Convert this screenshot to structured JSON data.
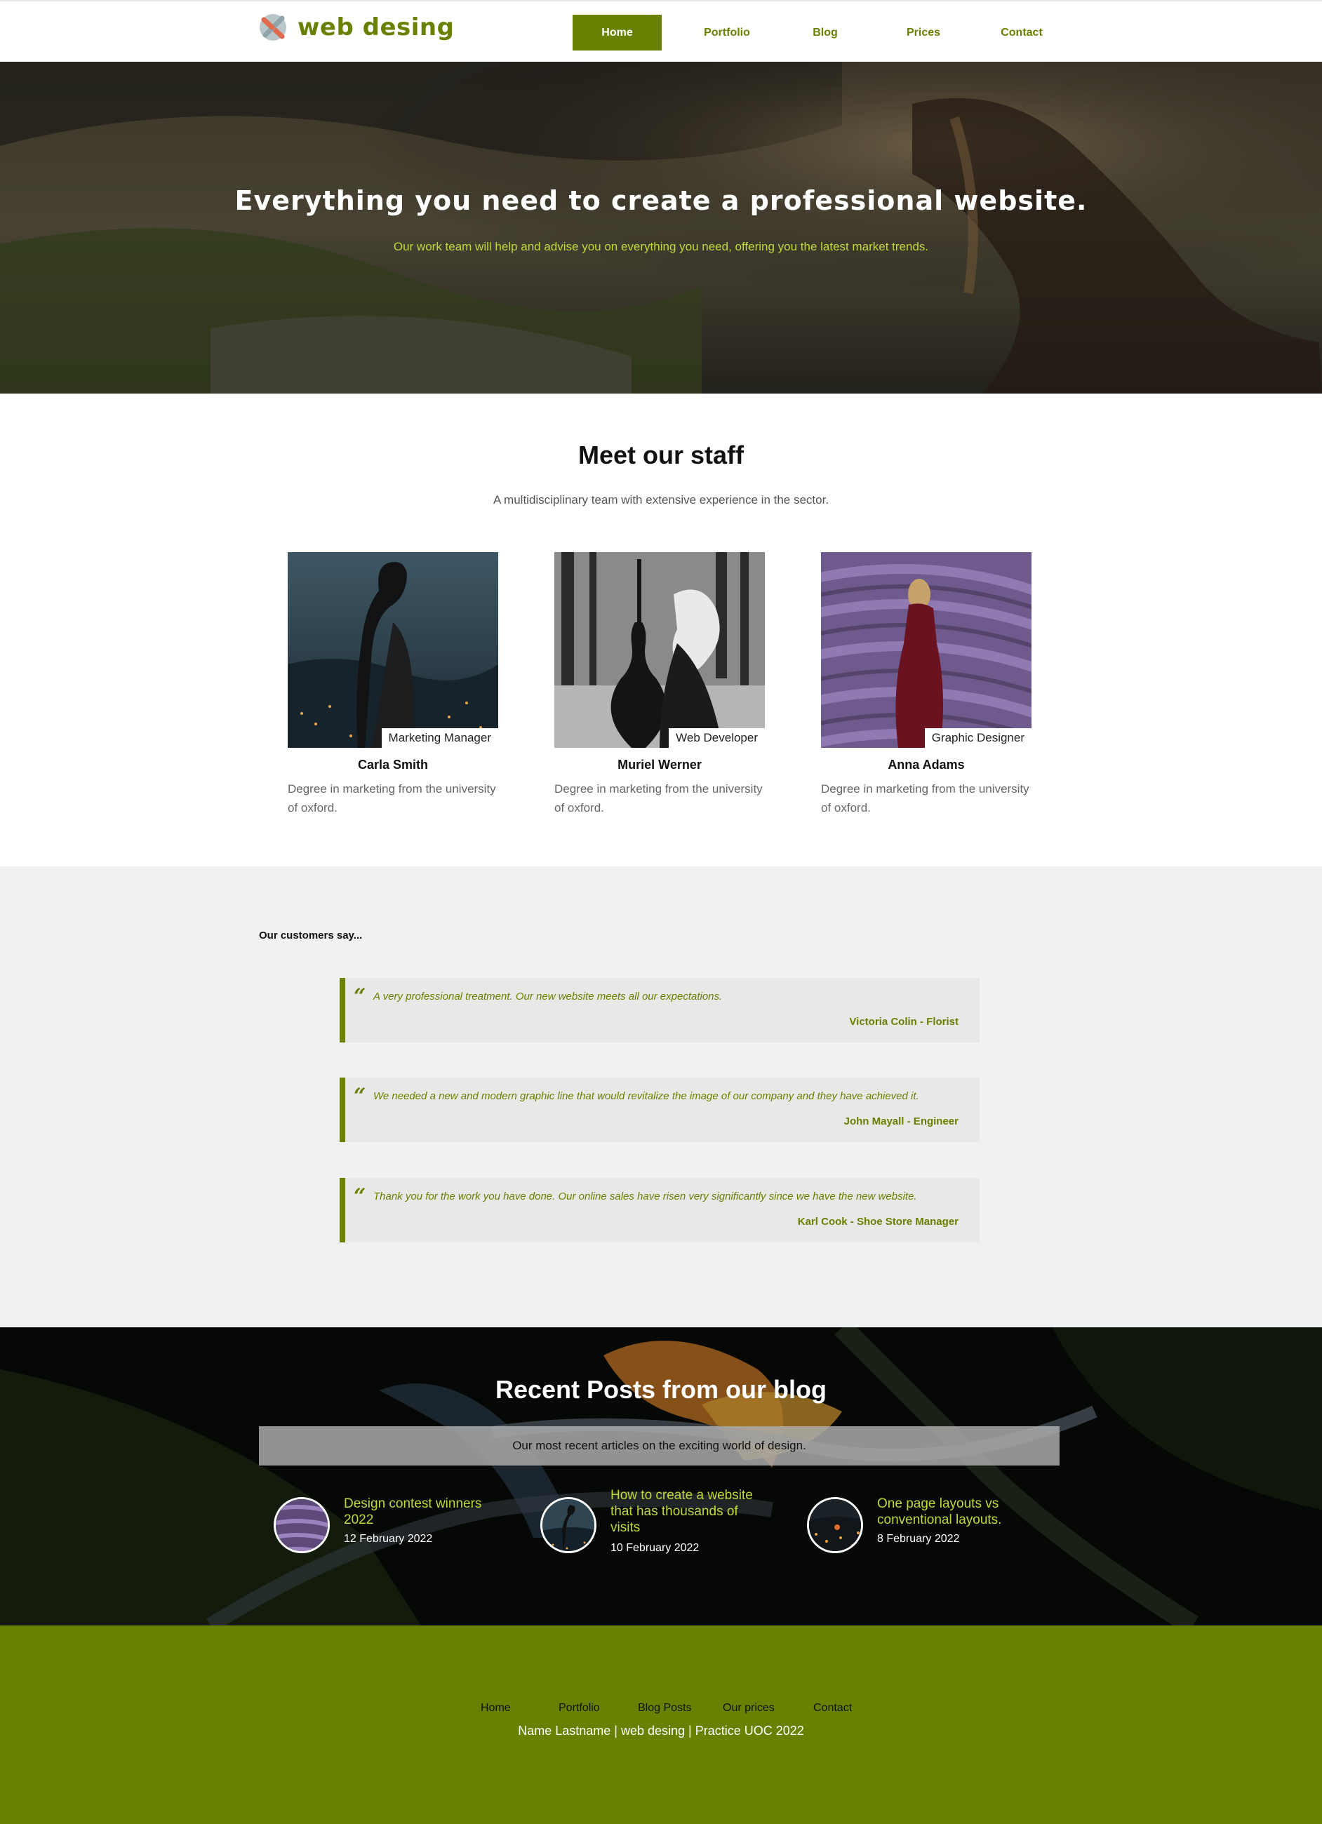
{
  "header": {
    "logo_text": "web desing",
    "nav": [
      {
        "label": "Home",
        "active": true
      },
      {
        "label": "Portfolio",
        "active": false
      },
      {
        "label": "Blog",
        "active": false
      },
      {
        "label": "Prices",
        "active": false
      },
      {
        "label": "Contact",
        "active": false
      }
    ]
  },
  "hero": {
    "title": "Everything you need to create a professional website.",
    "subtitle": "Our work team will help and advise you on everything you need, offering you the latest market trends."
  },
  "staff": {
    "title": "Meet our staff",
    "subtitle": "A multidisciplinary team with extensive experience in the sector.",
    "members": [
      {
        "role": "Marketing Manager",
        "name": "Carla Smith",
        "description": "Degree in marketing from the university of oxford."
      },
      {
        "role": "Web Developer",
        "name": "Muriel Werner",
        "description": "Degree in marketing from the university of oxford."
      },
      {
        "role": "Graphic Designer",
        "name": "Anna Adams",
        "description": "Degree in marketing from the university of oxford."
      }
    ]
  },
  "testimonials": {
    "title": "Our customers say...",
    "items": [
      {
        "quote": "A very professional treatment. Our new website meets all our expectations.",
        "author": "Victoria Colin - Florist"
      },
      {
        "quote": "We needed a new and modern graphic line that would revitalize the image of our company and they have achieved it.",
        "author": "John Mayall - Engineer"
      },
      {
        "quote": "Thank you for the work you have done. Our online sales have risen very significantly since we have the new website.",
        "author": "Karl Cook - Shoe Store Manager"
      }
    ]
  },
  "blog": {
    "title": "Recent Posts from our blog",
    "subtitle": "Our most recent articles on the exciting world of design.",
    "posts": [
      {
        "title": "Design contest winners 2022",
        "date": "12 February 2022"
      },
      {
        "title": "How to create a website that has thousands of visits",
        "date": "10 February 2022"
      },
      {
        "title": "One page layouts vs conventional layouts.",
        "date": "8 February 2022"
      }
    ]
  },
  "footer": {
    "links": [
      "Home",
      "Portfolio",
      "Blog Posts",
      "Our prices",
      "Contact"
    ],
    "credit": "Name Lastname | web desing | Practice UOC 2022"
  },
  "colors": {
    "brand_green": "#688100",
    "accent_yellow_green": "#c2d83a",
    "testimonials_bg": "#f0f1f2"
  },
  "icons": {
    "logo": "x-logo-icon",
    "quote": "quote-icon"
  }
}
